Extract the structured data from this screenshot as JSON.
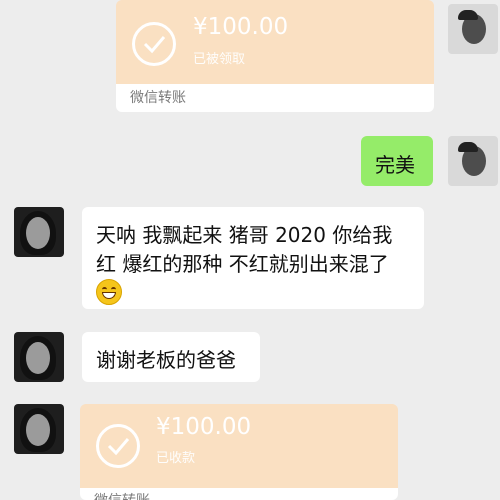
{
  "messages": {
    "transfer1": {
      "amount": "¥100.00",
      "status": "已被领取",
      "footer": "微信转账"
    },
    "perfect": {
      "text": "完美"
    },
    "message3": {
      "line1": "天呐 我飘起来 猪哥 2020 你给我",
      "line2": "红 爆红的那种 不红就别出来混了",
      "emoji": "grinning-face-emoji"
    },
    "thanks": {
      "text": "谢谢老板的爸爸"
    },
    "transfer2": {
      "amount": "¥100.00",
      "status": "已收款",
      "footer": "微信转账"
    }
  },
  "colors": {
    "background": "#ededed",
    "transfer_card": "#fae0c2",
    "green_bubble": "#95ec69",
    "white_bubble": "#ffffff"
  }
}
